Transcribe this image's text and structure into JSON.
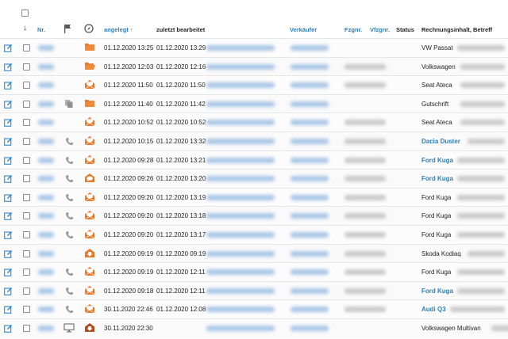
{
  "header": {
    "nr": "Nr.",
    "angelegt": "angelegt ↑",
    "zuletzt": "zuletzt bearbeitet",
    "verkaeufer": "Verkäufer",
    "fzgnr": "Fzgnr.",
    "vfzgnr": "Vfzgnr.",
    "status": "Status",
    "rechnung": "Rechnungsinhalt, Betreff"
  },
  "rows": [
    {
      "created": "01.12.2020 13:25",
      "edited": "01.12.2020 13:29",
      "subject": "VW Passat",
      "subject_link": false,
      "doc": "folder",
      "phone": false,
      "attach": false,
      "fzg": false
    },
    {
      "created": "01.12.2020 12:03",
      "edited": "01.12.2020 12:16",
      "subject": "Volkswagen",
      "subject_link": false,
      "doc": "folder-open",
      "phone": false,
      "attach": false,
      "fzg": true
    },
    {
      "created": "01.12.2020 11:50",
      "edited": "01.12.2020 11:50",
      "subject": "Seat Ateca",
      "subject_link": false,
      "doc": "envelope-open",
      "phone": false,
      "attach": false,
      "fzg": true
    },
    {
      "created": "01.12.2020 11:40",
      "edited": "01.12.2020 11:42",
      "subject": "Gutschrift",
      "subject_link": false,
      "doc": "folder",
      "phone": false,
      "attach": true,
      "fzg": false
    },
    {
      "created": "01.12.2020 10:52",
      "edited": "01.12.2020 10:52",
      "subject": "Seat Ateca",
      "subject_link": false,
      "doc": "envelope-open",
      "phone": false,
      "attach": false,
      "fzg": true
    },
    {
      "created": "01.12.2020 10:15",
      "edited": "01.12.2020 13:32",
      "subject": "Dacia Duster",
      "subject_link": true,
      "doc": "envelope-open",
      "phone": true,
      "attach": false,
      "fzg": true
    },
    {
      "created": "01.12.2020 09:28",
      "edited": "01.12.2020 13:21",
      "subject": "Ford Kuga",
      "subject_link": true,
      "doc": "envelope-open",
      "phone": true,
      "attach": false,
      "fzg": true
    },
    {
      "created": "01.12.2020 09:26",
      "edited": "01.12.2020 13:20",
      "subject": "Ford Kuga",
      "subject_link": true,
      "doc": "chat",
      "phone": true,
      "attach": false,
      "fzg": true
    },
    {
      "created": "01.12.2020 09:20",
      "edited": "01.12.2020 13:19",
      "subject": "Ford Kuga",
      "subject_link": false,
      "doc": "envelope-open",
      "phone": true,
      "attach": false,
      "fzg": true
    },
    {
      "created": "01.12.2020 09:20",
      "edited": "01.12.2020 13:18",
      "subject": "Ford Kuga",
      "subject_link": false,
      "doc": "envelope-open",
      "phone": true,
      "attach": false,
      "fzg": true
    },
    {
      "created": "01.12.2020 09:20",
      "edited": "01.12.2020 13:17",
      "subject": "Ford Kuga",
      "subject_link": false,
      "doc": "envelope-open",
      "phone": true,
      "attach": false,
      "fzg": true
    },
    {
      "created": "01.12.2020 09:19",
      "edited": "01.12.2020 09:19",
      "subject": "Skoda Kodiaq",
      "subject_link": false,
      "doc": "inbox",
      "phone": false,
      "attach": false,
      "fzg": true
    },
    {
      "created": "01.12.2020 09:19",
      "edited": "01.12.2020 12:11",
      "subject": "Ford Kuga",
      "subject_link": false,
      "doc": "envelope-open",
      "phone": true,
      "attach": false,
      "fzg": true
    },
    {
      "created": "01.12.2020 09:18",
      "edited": "01.12.2020 12:11",
      "subject": "Ford Kuga",
      "subject_link": true,
      "doc": "envelope-open",
      "phone": true,
      "attach": false,
      "fzg": true
    },
    {
      "created": "30.11.2020 22:46",
      "edited": "01.12.2020 12:08",
      "subject": "Audi Q3",
      "subject_link": true,
      "doc": "envelope-open",
      "phone": true,
      "attach": false,
      "fzg": true
    },
    {
      "created": "30.11.2020 22:30",
      "edited": "",
      "subject": "Volkswagen Multivan",
      "subject_link": false,
      "doc": "inbox-dark",
      "phone": false,
      "attach": false,
      "monitor": true,
      "fzg": false
    }
  ],
  "colors": {
    "orange": "#e8782a",
    "link": "#2b7fc0",
    "icon_blue": "#3f8fd0",
    "grey": "#8a8a8a"
  }
}
